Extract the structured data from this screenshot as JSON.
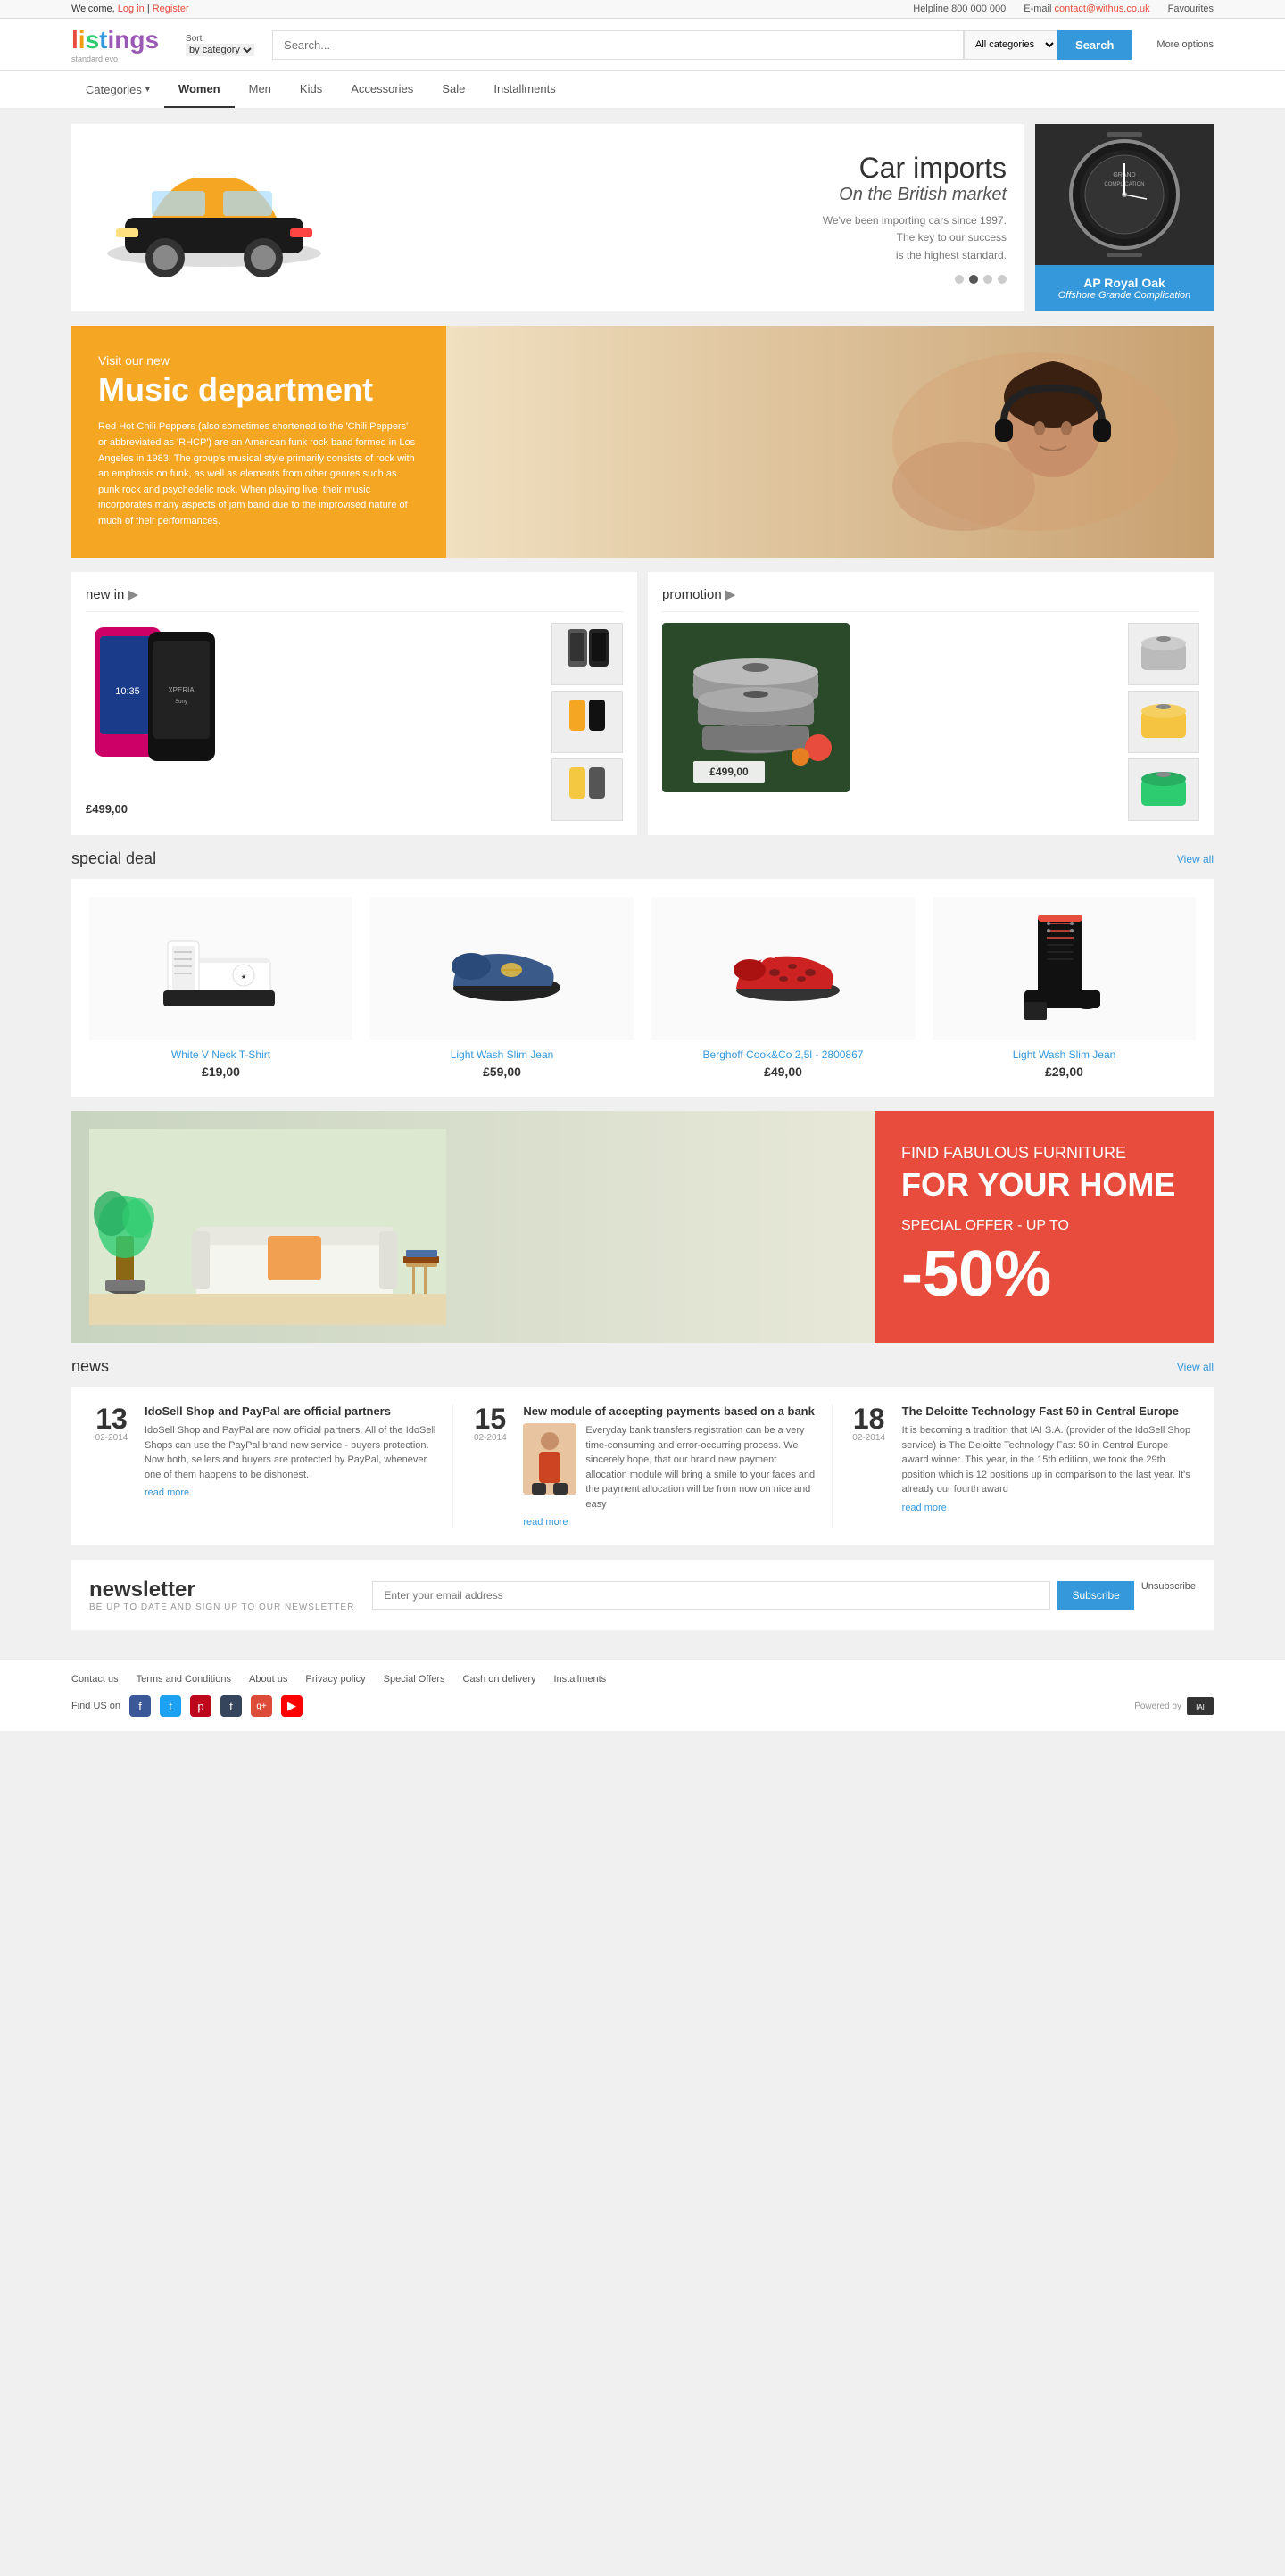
{
  "topbar": {
    "welcome": "Welcome,",
    "login": "Log in",
    "separator": "|",
    "register": "Register",
    "helpline_label": "Helpline",
    "helpline_number": "800 000 000",
    "email_label": "E-mail",
    "email_address": "contact@withus.co.uk",
    "favourites": "Favourites"
  },
  "header": {
    "logo": "listings",
    "logo_sub": "standard.evo",
    "sort_label": "Sort",
    "sort_sub": "by category",
    "search_placeholder": "Search...",
    "category_default": "All categories",
    "search_btn": "Search",
    "more_options": "More options"
  },
  "nav": {
    "categories": "Categories",
    "items": [
      {
        "label": "Women",
        "active": true
      },
      {
        "label": "Men",
        "active": false
      },
      {
        "label": "Kids",
        "active": false
      },
      {
        "label": "Accessories",
        "active": false
      },
      {
        "label": "Sale",
        "active": false
      },
      {
        "label": "Installments",
        "active": false
      }
    ]
  },
  "hero": {
    "title": "Car imports",
    "subtitle": "On the British market",
    "description": "We've been importing cars since 1997.\nThe key to our success\nis the highest standard.",
    "dots": 4,
    "active_dot": 1,
    "watch_brand": "AP Royal Oak",
    "watch_model": "Offshore Grande Complication"
  },
  "music": {
    "sub": "Visit our new",
    "title": "Music department",
    "desc": "Red Hot Chili Peppers (also sometimes shortened to the 'Chili Peppers' or abbreviated as 'RHCP') are an American funk rock band formed in Los Angeles in 1983. The group's musical style primarily consists of rock with an emphasis on funk, as well as elements from other genres such as punk rock and psychedelic rock. When playing live, their music incorporates many aspects of jam band due to the improvised nature of much of their performances."
  },
  "new_in": {
    "title": "new in",
    "price": "£499,00"
  },
  "promotion": {
    "title": "promotion",
    "price": "£499,00"
  },
  "special_deal": {
    "title": "special deal",
    "view_all": "View all",
    "products": [
      {
        "name": "White V Neck T-Shirt",
        "price": "£19,00"
      },
      {
        "name": "Light Wash Slim Jean",
        "price": "£59,00"
      },
      {
        "name": "Berghoff Cook&Co 2,5l - 2800867",
        "price": "£49,00"
      },
      {
        "name": "Light Wash Slim Jean",
        "price": "£29,00"
      }
    ]
  },
  "furniture": {
    "label": "FIND FABULOUS FURNITURE",
    "title": "FOR YOUR HOME",
    "offer": "SPECIAL OFFER - UP TO",
    "discount": "-50%"
  },
  "news": {
    "title": "news",
    "view_all": "View all",
    "items": [
      {
        "day": "13",
        "month": "02-2014",
        "title": "IdoSell Shop and PayPal are official partners",
        "body": "IdoSell Shop and PayPal are now official partners. All of the IdoSell Shops can use the PayPal brand new service - buyers protection. Now both, sellers and buyers are protected by PayPal, whenever one of them happens to be dishonest.",
        "read_more": "read more"
      },
      {
        "day": "15",
        "month": "02-2014",
        "title": "New module of accepting payments based on a bank",
        "body": "Everyday bank transfers registration can be a very time-consuming and error-occurring process. We sincerely hope, that our brand new payment allocation module will bring a smile to your faces and the payment allocation will be from now on nice and easy",
        "read_more": "read more"
      },
      {
        "day": "18",
        "month": "02-2014",
        "title": "The Deloitte Technology Fast 50 in Central Europe",
        "body": "It is becoming a tradition that IAI S.A. (provider of the IdoSell Shop service) is The Deloitte Technology Fast 50 in Central Europe award winner. This year, in the 15th edition, we took the 29th position which is 12 positions up in comparison to the last year. It's already our fourth award",
        "read_more": "read more"
      }
    ]
  },
  "newsletter": {
    "title": "newsletter",
    "subtitle": "BE UP TO DATE AND SIGN UP TO OUR NEWSLETTER",
    "placeholder": "Enter your email address",
    "subscribe": "Subscribe",
    "unsubscribe": "Unsubscribe"
  },
  "footer": {
    "links": [
      "Contact us",
      "Terms and Conditions",
      "About us",
      "Privacy policy",
      "Special Offers",
      "Cash on delivery",
      "Installments"
    ],
    "find_us": "Find US on",
    "social": [
      "f",
      "t",
      "p",
      "t",
      "g+",
      "▶"
    ],
    "powered": "Powered by"
  }
}
